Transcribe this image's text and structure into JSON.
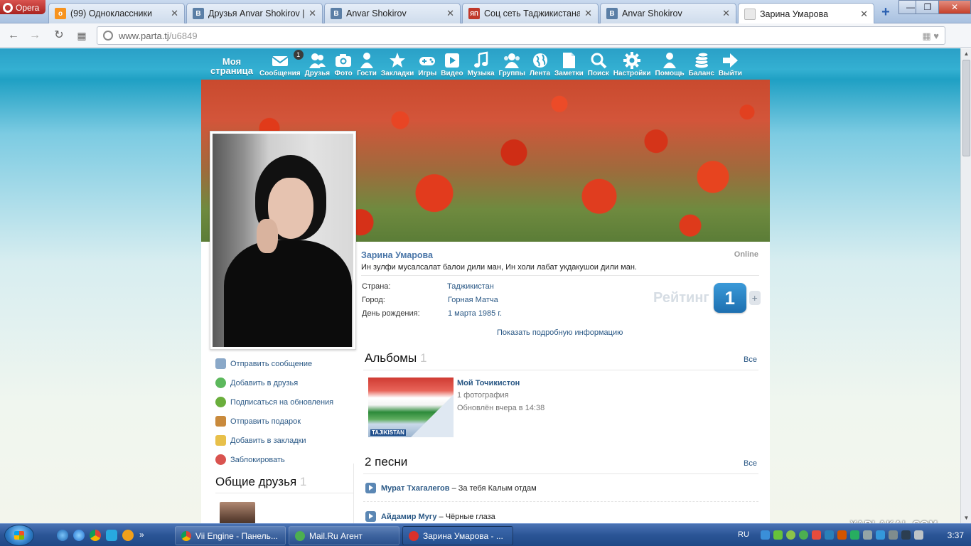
{
  "browser": {
    "opera_label": "Opera",
    "tabs": [
      {
        "title": "(99) Одноклассники",
        "favicon": "odnoklassniki-icon",
        "color": "#f7931e",
        "active": false
      },
      {
        "title": "Друзья Anvar Shokirov | В",
        "favicon": "vk-icon",
        "color": "#5b7fa6",
        "active": false
      },
      {
        "title": "Anvar Shokirov",
        "favicon": "vk-icon",
        "color": "#5b7fa6",
        "active": false
      },
      {
        "title": "Соц сеть Таджикистана",
        "favicon": "yaplakal-icon",
        "color": "#c0392b",
        "active": false
      },
      {
        "title": "Anvar Shokirov",
        "favicon": "vk-icon",
        "color": "#5b7fa6",
        "active": false
      },
      {
        "title": "Зарина Умарова",
        "favicon": "page-icon",
        "color": "#cccccc",
        "active": true
      }
    ],
    "url_domain": "www.parta.tj",
    "url_path": "/u6849"
  },
  "topmenu": {
    "my_page": "Моя страница",
    "items": [
      {
        "label": "Сообщения",
        "icon": "envelope-icon",
        "badge": "1"
      },
      {
        "label": "Друзья",
        "icon": "friends-icon"
      },
      {
        "label": "Фото",
        "icon": "camera-icon"
      },
      {
        "label": "Гости",
        "icon": "guest-icon"
      },
      {
        "label": "Закладки",
        "icon": "star-icon"
      },
      {
        "label": "Игры",
        "icon": "gamepad-icon"
      },
      {
        "label": "Видео",
        "icon": "play-icon"
      },
      {
        "label": "Музыка",
        "icon": "music-note-icon"
      },
      {
        "label": "Группы",
        "icon": "groups-icon"
      },
      {
        "label": "Лента",
        "icon": "globe-icon"
      },
      {
        "label": "Заметки",
        "icon": "note-icon"
      },
      {
        "label": "Поиск",
        "icon": "search-icon"
      },
      {
        "label": "Настройки",
        "icon": "gear-icon"
      },
      {
        "label": "Помощь",
        "icon": "help-person-icon"
      },
      {
        "label": "Баланс",
        "icon": "coins-icon"
      },
      {
        "label": "Выйти",
        "icon": "exit-arrow-icon"
      }
    ]
  },
  "profile": {
    "name": "Зарина Умарова",
    "online": "Online",
    "status": "Ин зулфи мусалсалат балои дили ман, Ин холи лабат укдакушои дили ман.",
    "info": [
      {
        "key": "Страна:",
        "value": "Таджикистан"
      },
      {
        "key": "Город:",
        "value": "Горная Матча"
      },
      {
        "key": "День рождения:",
        "value": "1 марта 1985 г."
      }
    ],
    "rating_label": "Рейтинг",
    "rating_value": "1",
    "rating_plus": "+",
    "more_info": "Показать подробную информацию"
  },
  "albums": {
    "title": "Альбомы",
    "count": "1",
    "all": "Все",
    "items": [
      {
        "name": "Мой Точикистон",
        "photos": "1 фотография",
        "updated": "Обновлён вчера в 14:38",
        "thumb_text": "TAJIKISTAN"
      }
    ]
  },
  "songs": {
    "title": "2 песни",
    "all": "Все",
    "items": [
      {
        "artist": "Мурат Тхагалегов",
        "title": "– За тебя Калым отдам"
      },
      {
        "artist": "Айдамир Мугу",
        "title": "– Чёрные глаза"
      }
    ]
  },
  "actions": [
    {
      "label": "Отправить сообщение",
      "icon": "mail-icon",
      "color": "#8aa8c8"
    },
    {
      "label": "Добавить в друзья",
      "icon": "add-circle-icon",
      "color": "#5cb85c"
    },
    {
      "label": "Подписаться на обновления",
      "icon": "refresh-icon",
      "color": "#6aae3c"
    },
    {
      "label": "Отправить подарок",
      "icon": "gift-icon",
      "color": "#c98a3c"
    },
    {
      "label": "Добавить в закладки",
      "icon": "bookmark-star-icon",
      "color": "#e8c04a"
    },
    {
      "label": "Заблокировать",
      "icon": "block-icon",
      "color": "#d9534f"
    }
  ],
  "common_friends": {
    "title": "Общие друзья",
    "count": "1"
  },
  "watermark": "YAPLAKAL.COM",
  "taskbar": {
    "buttons": [
      {
        "label": "Vii Engine - Панель...",
        "icon": "chrome-icon",
        "color": "#e8b52d",
        "active": false
      },
      {
        "label": "Mail.Ru Агент",
        "icon": "mailru-agent-icon",
        "color": "#4caf50",
        "active": false
      },
      {
        "label": "Зарина Умарова - ...",
        "icon": "opera-icon",
        "color": "#d9312b",
        "active": true
      }
    ],
    "lang": "RU",
    "clock": "3:37"
  }
}
